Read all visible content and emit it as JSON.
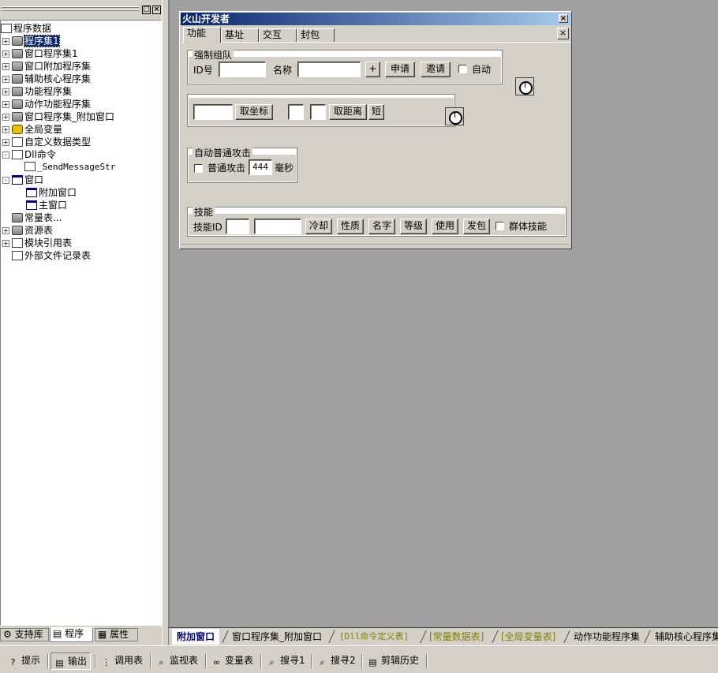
{
  "project_panel": {
    "tree": [
      {
        "label": "程序数据",
        "icon": "project-data-icon"
      },
      {
        "label": "程序集1",
        "icon": "assembly-icon",
        "selected": true
      },
      {
        "label": "窗口程序集1",
        "icon": "assembly-icon"
      },
      {
        "label": "窗口附加程序集",
        "icon": "assembly-icon"
      },
      {
        "label": "辅助核心程序集",
        "icon": "assembly-icon"
      },
      {
        "label": "功能程序集",
        "icon": "assembly-icon"
      },
      {
        "label": "动作功能程序集",
        "icon": "assembly-icon"
      },
      {
        "label": "窗口程序集_附加窗口",
        "icon": "assembly-icon"
      },
      {
        "label": "全局变量",
        "icon": "global-variable-icon"
      },
      {
        "label": "自定义数据类型",
        "icon": "custom-data-type-icon"
      },
      {
        "label": "Dll命令",
        "icon": "dll-command-icon"
      },
      {
        "label": "_SendMessageStr",
        "icon": "dll-command-icon"
      },
      {
        "label": "窗口",
        "icon": "window-icon"
      },
      {
        "label": "附加窗口",
        "icon": "window-icon"
      },
      {
        "label": "主窗口",
        "icon": "window-icon"
      },
      {
        "label": "常量表...",
        "icon": "constant-table-icon"
      },
      {
        "label": "资源表",
        "icon": "resource-table-icon"
      },
      {
        "label": "模块引用表",
        "icon": "module-reference-icon"
      },
      {
        "label": "外部文件记录表",
        "icon": "external-file-icon"
      }
    ],
    "tabs": [
      {
        "label": "支持库",
        "icon": "support-library-icon"
      },
      {
        "label": "程序",
        "icon": "program-icon",
        "active": true
      },
      {
        "label": "属性",
        "icon": "properties-icon"
      }
    ]
  },
  "form": {
    "title": "火山开发者",
    "close": "×",
    "tabs": [
      "功能",
      "基址",
      "交互",
      "封包"
    ],
    "active_tab": "功能",
    "group_team": {
      "title": "强制组队",
      "id_label": "ID号",
      "id_value": "",
      "name_label": "名称",
      "name_value": "",
      "plus_button": "+",
      "apply_button": "申请",
      "invite_button": "邀请",
      "auto_checkbox": "自动",
      "auto_checked": false
    },
    "coords_panel": {
      "coord_value": "",
      "get_coord_button": "取坐标",
      "dist_a": "",
      "dist_b": "",
      "get_distance_button": "取距离",
      "short_button": "短"
    },
    "group_auto_attack": {
      "title": "自动普通攻击",
      "attack_checkbox": "普通攻击",
      "attack_checked": false,
      "interval_value": "444",
      "unit": "毫秒"
    },
    "group_skill": {
      "title": "技能",
      "skill_id_label": "技能ID",
      "skill_id_value": "",
      "skill_name_value": "",
      "buttons": [
        "冷却",
        "性质",
        "名字",
        "等级",
        "使用",
        "发包"
      ],
      "group_skill_checkbox": "群体技能",
      "group_skill_checked": false
    }
  },
  "doc_tabs": [
    {
      "label": "附加窗口",
      "active": true
    },
    {
      "label": "窗口程序集_附加窗口"
    },
    {
      "label": "[Dll命令定义表]",
      "olive": true
    },
    {
      "label": "[常量数据表]",
      "olive": true
    },
    {
      "label": "[全局变量表]",
      "olive": true
    },
    {
      "label": "动作功能程序集"
    },
    {
      "label": "辅助核心程序集"
    }
  ],
  "bottom_bar": [
    {
      "label": "提示",
      "icon": "hint-icon"
    },
    {
      "label": "输出",
      "icon": "output-icon",
      "active": true
    },
    {
      "label": "调用表",
      "icon": "call-table-icon"
    },
    {
      "label": "监视表",
      "icon": "watch-table-icon"
    },
    {
      "label": "变量表",
      "icon": "variable-table-icon"
    },
    {
      "label": "搜寻1",
      "icon": "search1-icon"
    },
    {
      "label": "搜寻2",
      "icon": "search2-icon"
    },
    {
      "label": "剪辑历史",
      "icon": "clipboard-history-icon"
    }
  ],
  "colors": {
    "face": "#d4d0c8",
    "workspace": "#a0a0a0",
    "selection": "#0a246a",
    "title_gradient_end": "#a6caf0",
    "olive_tab_text": "#808000"
  }
}
